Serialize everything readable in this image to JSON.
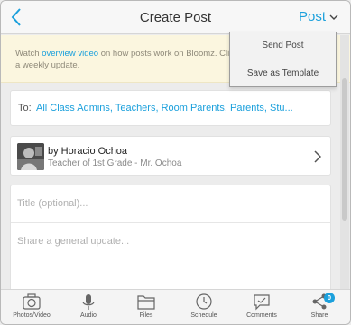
{
  "header": {
    "title": "Create Post",
    "post_label": "Post"
  },
  "banner": {
    "text_before": "Watch ",
    "link_text": "overview video",
    "text_after": " on how posts work on Bloomz. Click '",
    "line2": "a weekly update."
  },
  "dropdown": {
    "items": [
      {
        "label": "Send Post"
      },
      {
        "label": "Save as Template"
      }
    ]
  },
  "recipients": {
    "label": "To:",
    "value": "All Class Admins, Teachers, Room Parents, Parents, Stu..."
  },
  "author": {
    "name": "by Horacio Ochoa",
    "subtitle": "Teacher of 1st Grade - Mr. Ochoa"
  },
  "compose": {
    "title_placeholder": "Title (optional)...",
    "body_placeholder": "Share a general update..."
  },
  "toolbar": {
    "items": [
      {
        "label": "Photos/Video",
        "icon": "camera-icon"
      },
      {
        "label": "Audio",
        "icon": "microphone-icon"
      },
      {
        "label": "Files",
        "icon": "folder-icon"
      },
      {
        "label": "Schedule",
        "icon": "clock-icon"
      },
      {
        "label": "Comments",
        "icon": "comment-icon"
      },
      {
        "label": "Share",
        "icon": "share-icon",
        "badge": "0"
      }
    ]
  },
  "colors": {
    "accent": "#1ba0dc",
    "banner_bg": "#fbf6df",
    "page_bg": "#ececec"
  }
}
